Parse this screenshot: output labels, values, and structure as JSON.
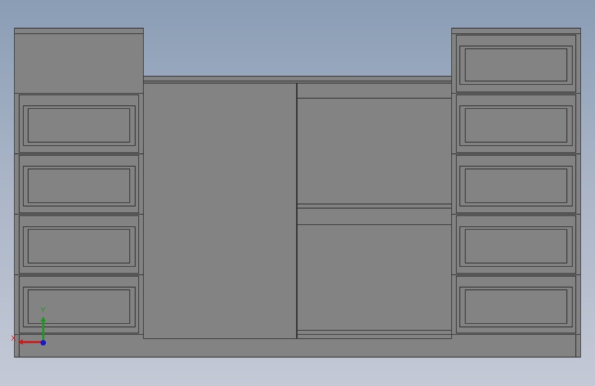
{
  "viewport": {
    "background_top": "#8a9db5",
    "background_bottom": "#c4c9d6"
  },
  "model": {
    "body_color": "#838383",
    "edge_color": "#2a2a2a",
    "left_column": {
      "drawers": 4,
      "top_panel": true
    },
    "right_column": {
      "drawers": 5
    },
    "center_left": {
      "type": "door"
    },
    "center_right": {
      "type": "door-with-split-rail"
    }
  },
  "triad": {
    "x_label": "X",
    "y_label": "Y",
    "x_color": "#cc1a1a",
    "y_color": "#1a9a1a",
    "z_color": "#1a1acc"
  }
}
